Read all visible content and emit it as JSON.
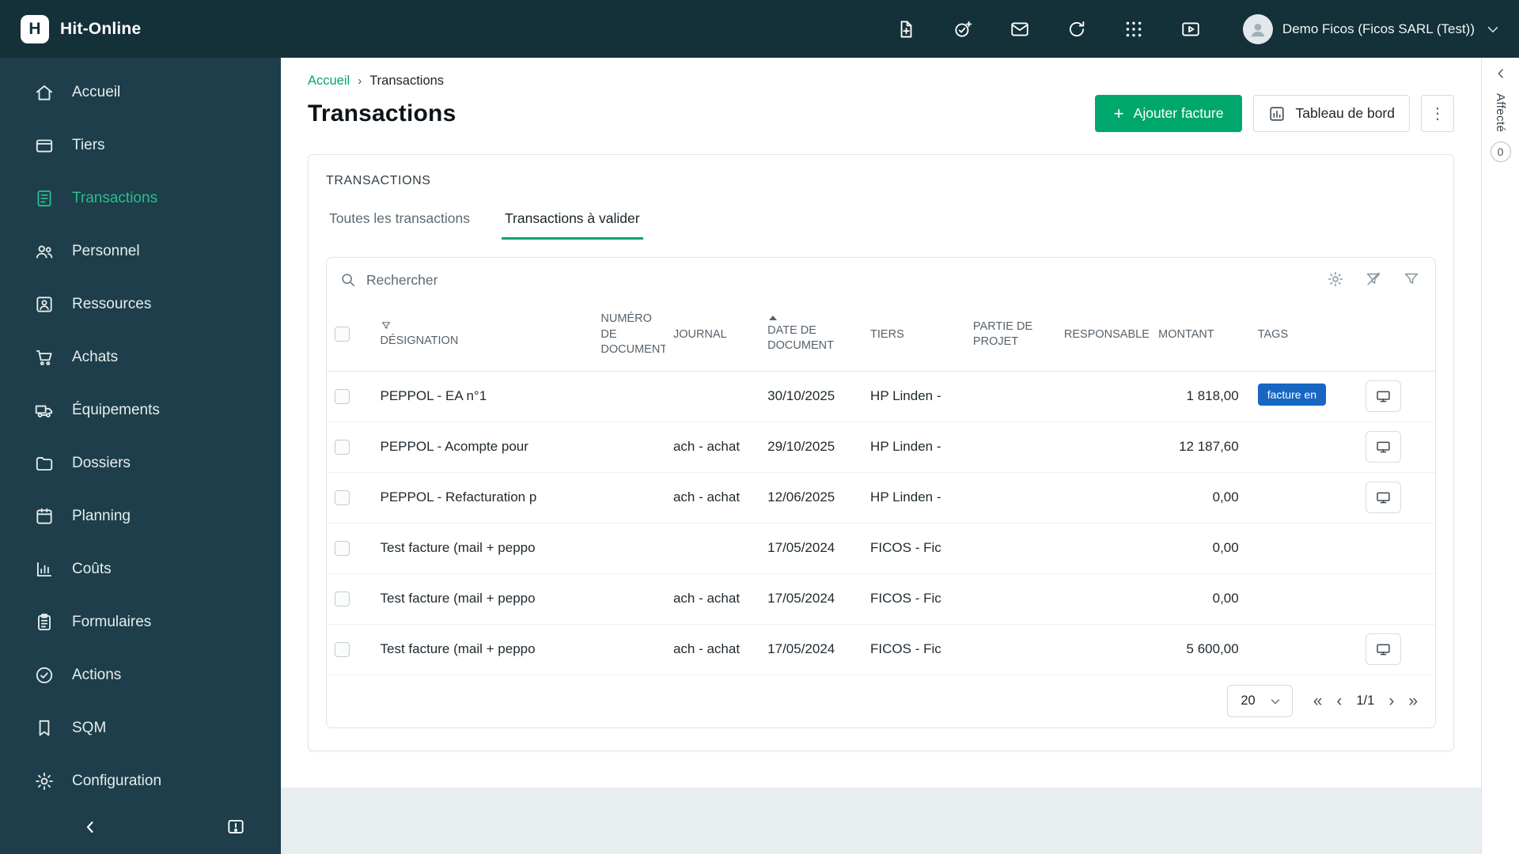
{
  "app": {
    "title": "Hit-Online",
    "logo_letter": "H"
  },
  "topbar": {
    "user": "Demo Ficos (Ficos SARL (Test))"
  },
  "sidebar": {
    "items": [
      {
        "label": "Accueil"
      },
      {
        "label": "Tiers"
      },
      {
        "label": "Transactions"
      },
      {
        "label": "Personnel"
      },
      {
        "label": "Ressources"
      },
      {
        "label": "Achats"
      },
      {
        "label": "Équipements"
      },
      {
        "label": "Dossiers"
      },
      {
        "label": "Planning"
      },
      {
        "label": "Coûts"
      },
      {
        "label": "Formulaires"
      },
      {
        "label": "Actions"
      },
      {
        "label": "SQM"
      },
      {
        "label": "Configuration"
      }
    ],
    "active_item": "Transactions"
  },
  "breadcrumb": {
    "home": "Accueil",
    "sep": "›",
    "current": "Transactions"
  },
  "page": {
    "title": "Transactions",
    "add_label": "Ajouter facture",
    "dashboard_label": "Tableau de bord"
  },
  "panel": {
    "title": "TRANSACTIONS",
    "tab_all": "Toutes les transactions",
    "tab_validate": "Transactions à valider"
  },
  "search": {
    "placeholder": "Rechercher"
  },
  "table": {
    "headers": {
      "designation": "DÉSIGNATION",
      "numero": "NUMÉRO DE DOCUMENT",
      "journal": "JOURNAL",
      "date": "DATE DE DOCUMENT",
      "tiers": "TIERS",
      "partie": "PARTIE DE PROJET",
      "responsable": "RESPONSABLE",
      "montant": "MONTANT",
      "tags": "TAGS"
    },
    "rows": [
      {
        "designation": "PEPPOL - EA n°1",
        "numero": "",
        "journal": "",
        "date": "30/10/2025",
        "tiers": "HP Linden -",
        "partie": "",
        "responsable": "",
        "montant": "1 818,00",
        "tag": "facture en"
      },
      {
        "designation": "PEPPOL - Acompte pour",
        "numero": "",
        "journal": "ach - achat",
        "date": "29/10/2025",
        "tiers": "HP Linden -",
        "partie": "",
        "responsable": "",
        "montant": "12 187,60",
        "tag": ""
      },
      {
        "designation": "PEPPOL - Refacturation p",
        "numero": "",
        "journal": "ach - achat",
        "date": "12/06/2025",
        "tiers": "HP Linden -",
        "partie": "",
        "responsable": "",
        "montant": "0,00",
        "tag": ""
      },
      {
        "designation": "Test facture (mail + peppo",
        "numero": "",
        "journal": "",
        "date": "17/05/2024",
        "tiers": "FICOS - Fic",
        "partie": "",
        "responsable": "",
        "montant": "0,00",
        "tag": ""
      },
      {
        "designation": "Test facture (mail + peppo",
        "numero": "",
        "journal": "ach - achat",
        "date": "17/05/2024",
        "tiers": "FICOS - Fic",
        "partie": "",
        "responsable": "",
        "montant": "0,00",
        "tag": ""
      },
      {
        "designation": "Test facture (mail + peppo",
        "numero": "",
        "journal": "ach - achat",
        "date": "17/05/2024",
        "tiers": "FICOS - Fic",
        "partie": "",
        "responsable": "",
        "montant": "5 600,00",
        "tag": ""
      }
    ]
  },
  "pagination": {
    "page_size": "20",
    "page_info": "1/1"
  },
  "right_panel": {
    "label": "Affecté",
    "badge": "0"
  },
  "icons": {
    "plus": "+",
    "kebab": "⋮",
    "first_page": "«",
    "prev_page": "‹",
    "next_page": "›",
    "last_page": "»"
  },
  "colors": {
    "brand_dark": "#143039",
    "sidebar_dark": "#1d3e4a",
    "accent_green": "#00a76d",
    "tag_blue": "#1766c2"
  }
}
